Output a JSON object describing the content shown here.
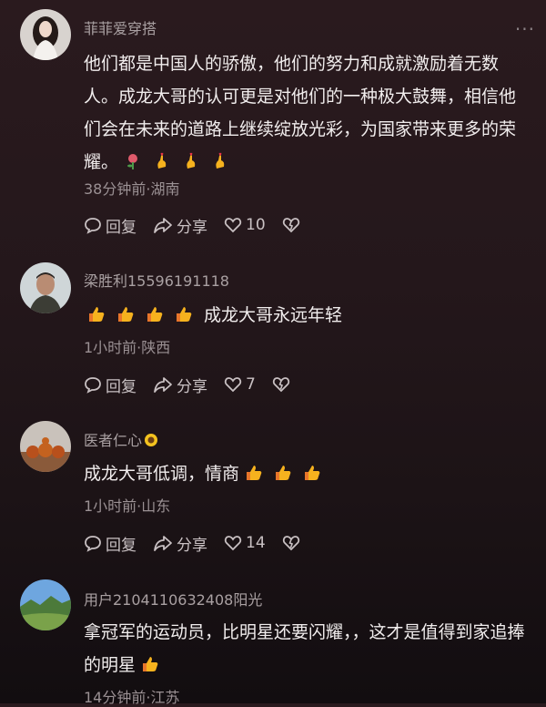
{
  "comments": [
    {
      "user": "菲菲爱穿搭",
      "text": "他们都是中国人的骄傲，他们的努力和成就激励着无数人。成龙大哥的认可更是对他们的一种极大鼓舞，相信他们会在未来的道路上继续绽放光彩，为国家带来更多的荣耀。",
      "emojis": [
        "rose-emoji",
        "finger-heart-emoji",
        "finger-heart-emoji",
        "finger-heart-emoji"
      ],
      "meta": "38分钟前·湖南",
      "reply": "回复",
      "share": "分享",
      "likes": "10"
    },
    {
      "user": "梁胜利15596191118",
      "text": "成龙大哥永远年轻",
      "emojis": [
        "thumbs-up-emoji",
        "thumbs-up-emoji",
        "thumbs-up-emoji",
        "thumbs-up-emoji"
      ],
      "meta": "1小时前·陕西",
      "reply": "回复",
      "share": "分享",
      "likes": "7"
    },
    {
      "user": "医者仁心",
      "text": "成龙大哥低调，情商",
      "emojis": [
        "thumbs-up-emoji",
        "thumbs-up-emoji",
        "thumbs-up-emoji"
      ],
      "meta": "1小时前·山东",
      "reply": "回复",
      "share": "分享",
      "likes": "14"
    },
    {
      "user": "用户2104110632408阳光",
      "text": "拿冠军的运动员，比明星还要闪耀，，这才是值得到家追捧的明星",
      "emojis": [
        "thumbs-up-emoji"
      ],
      "meta": "14分钟前·江苏"
    }
  ],
  "more_label": "···",
  "colors": {
    "background": "#24171b",
    "meta_text": "#9b9194",
    "emoji_yellow": "#f6b21e"
  }
}
